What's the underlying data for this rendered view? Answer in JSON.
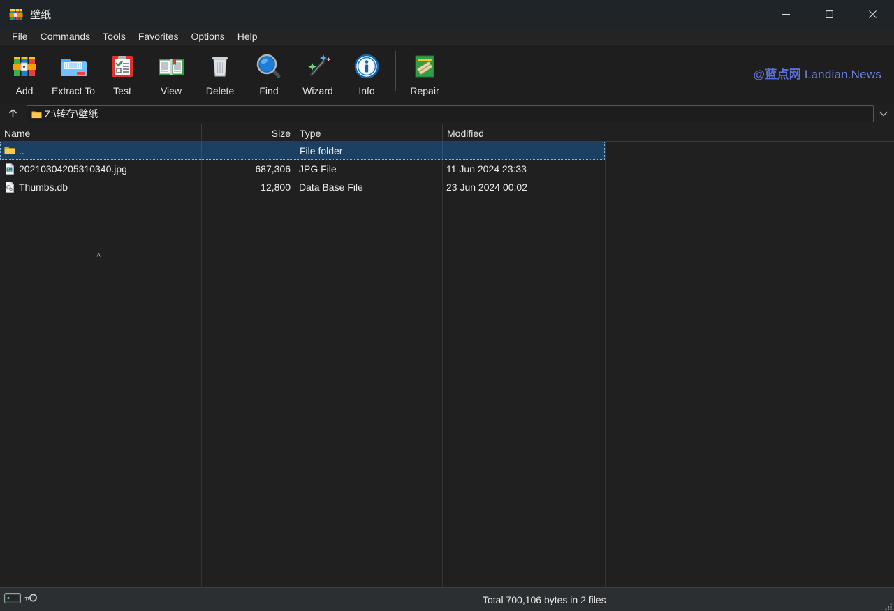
{
  "window": {
    "title": "壁纸",
    "app_icon": "winrar-books-icon",
    "controls": [
      {
        "name": "minimize-button",
        "glyph": "minimize-icon"
      },
      {
        "name": "maximize-button",
        "glyph": "maximize-icon"
      },
      {
        "name": "close-button",
        "glyph": "close-icon"
      }
    ]
  },
  "menubar": {
    "items": [
      {
        "label": "File",
        "accel": "F"
      },
      {
        "label": "Commands",
        "accel": "C"
      },
      {
        "label": "Tools",
        "accel": "s"
      },
      {
        "label": "Favorites",
        "accel": "o"
      },
      {
        "label": "Options",
        "accel": "n"
      },
      {
        "label": "Help",
        "accel": "H"
      }
    ]
  },
  "toolbar": {
    "buttons": [
      {
        "label": "Add",
        "icon": "add-archive-icon"
      },
      {
        "label": "Extract To",
        "icon": "extract-folder-icon"
      },
      {
        "label": "Test",
        "icon": "test-clipboard-icon"
      },
      {
        "label": "View",
        "icon": "view-book-icon"
      },
      {
        "label": "Delete",
        "icon": "delete-trash-icon"
      },
      {
        "label": "Find",
        "icon": "find-magnifier-icon"
      },
      {
        "label": "Wizard",
        "icon": "wizard-wand-icon"
      },
      {
        "label": "Info",
        "icon": "info-circle-icon"
      },
      {
        "label": "Repair",
        "icon": "repair-bandage-icon"
      }
    ],
    "watermark_cn": "@蓝点网",
    "watermark_en": "Landian.News",
    "watermark_color": "#5b6fd6"
  },
  "addressbar": {
    "up_icon": "arrow-up-icon",
    "folder_icon": "folder-icon",
    "path": "Z:\\转存\\壁纸",
    "dropdown_icon": "chevron-down-icon"
  },
  "filelist": {
    "sort_indicator": "˄",
    "sort_column": "Name",
    "sort_direction": "ascending",
    "columns": [
      {
        "label": "Name",
        "key": "name"
      },
      {
        "label": "Size",
        "key": "size"
      },
      {
        "label": "Type",
        "key": "type"
      },
      {
        "label": "Modified",
        "key": "modified"
      }
    ],
    "rows": [
      {
        "name": "..",
        "size": "",
        "type": "File folder",
        "modified": "",
        "icon": "folder-icon",
        "selected": true
      },
      {
        "name": "20210304205310340.jpg",
        "size": "687,306",
        "type": "JPG File",
        "modified": "11 Jun 2024 23:33",
        "icon": "image-file-icon",
        "selected": false
      },
      {
        "name": "Thumbs.db",
        "size": "12,800",
        "type": "Data Base File",
        "modified": "23 Jun 2024 00:02",
        "icon": "database-file-icon",
        "selected": false
      }
    ]
  },
  "statusbar": {
    "drive_icon": "drive-icon",
    "key_icon": "key-icon",
    "total_text": "Total 700,106 bytes in 2 files",
    "resize_grip": "resize-grip-icon"
  },
  "colors": {
    "window_bg": "#202020",
    "titlebar_bg": "#1f2428",
    "toolbar_bg": "#1e1e1e",
    "statusbar_bg": "#2b2f31",
    "selection_blue": "#1c4061",
    "text": "#ededed"
  }
}
